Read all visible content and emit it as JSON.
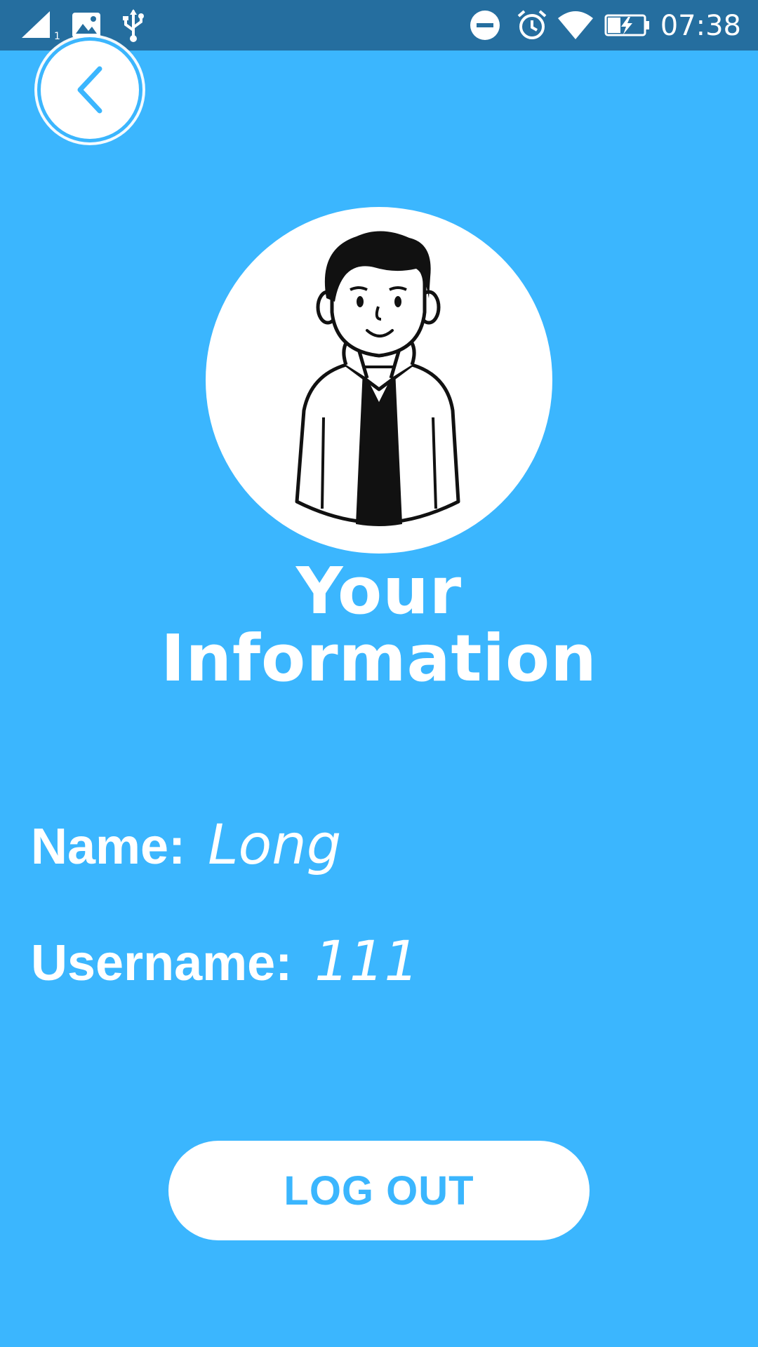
{
  "status_bar": {
    "time": "07:38",
    "icons": [
      "cell-signal-icon",
      "image-icon",
      "usb-icon",
      "do-not-disturb-icon",
      "alarm-icon",
      "wifi-icon",
      "battery-charging-icon"
    ]
  },
  "nav": {
    "back_icon": "chevron-left-icon"
  },
  "profile": {
    "title_line1": "Your",
    "title_line2": "Information",
    "name_label": "Name:",
    "name_value": "Long",
    "username_label": "Username:",
    "username_value": "111"
  },
  "actions": {
    "logout_label": "LOG OUT"
  },
  "colors": {
    "background": "#3bb6fe",
    "status_bar": "#256e9f",
    "accent": "#3bb6fe",
    "surface": "#ffffff"
  }
}
